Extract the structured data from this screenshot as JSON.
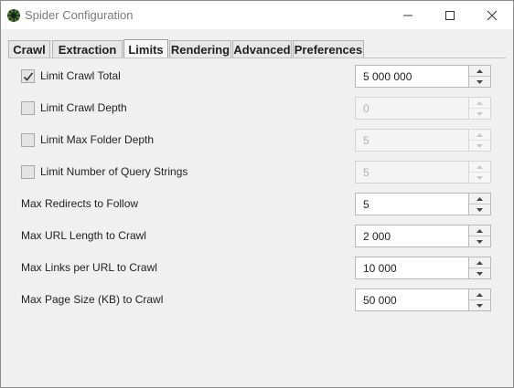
{
  "window": {
    "title": "Spider Configuration",
    "icons": {
      "app": "spider-app-icon",
      "minimize": "minimize-icon",
      "maximize": "maximize-icon",
      "close": "close-icon"
    }
  },
  "tabs": [
    {
      "label": "Crawl",
      "active": false
    },
    {
      "label": "Extraction",
      "active": false
    },
    {
      "label": "Limits",
      "active": true
    },
    {
      "label": "Rendering",
      "active": false
    },
    {
      "label": "Advanced",
      "active": false
    },
    {
      "label": "Preferences",
      "active": false
    }
  ],
  "limits": {
    "limit_crawl_total": {
      "label": "Limit Crawl Total",
      "checked": true,
      "value": "5 000 000",
      "enabled": true
    },
    "limit_crawl_depth": {
      "label": "Limit Crawl Depth",
      "checked": false,
      "value": "0",
      "enabled": false
    },
    "limit_max_folder_depth": {
      "label": "Limit Max Folder Depth",
      "checked": false,
      "value": "5",
      "enabled": false
    },
    "limit_query_strings": {
      "label": "Limit Number of Query Strings",
      "checked": false,
      "value": "5",
      "enabled": false
    },
    "max_redirects": {
      "label": "Max Redirects to Follow",
      "value": "5",
      "enabled": true
    },
    "max_url_length": {
      "label": "Max URL Length to Crawl",
      "value": "2 000",
      "enabled": true
    },
    "max_links_per_url": {
      "label": "Max Links per URL to Crawl",
      "value": "10 000",
      "enabled": true
    },
    "max_page_size": {
      "label": "Max Page Size (KB) to Crawl",
      "value": "50 000",
      "enabled": true
    }
  },
  "colors": {
    "window_bg": "#f0f0f0",
    "title_text": "#7a7a7a",
    "app_icon_green": "#3d7a2c"
  }
}
